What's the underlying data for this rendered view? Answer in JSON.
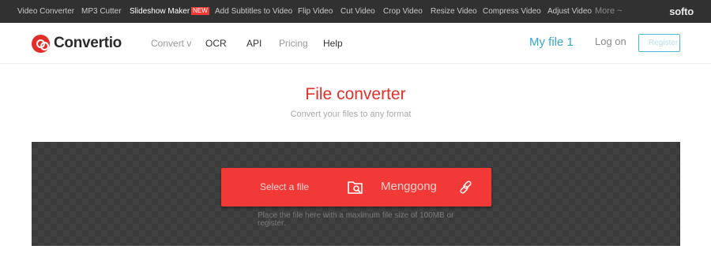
{
  "topbar": {
    "links": [
      {
        "label": "Video Converter",
        "active": false
      },
      {
        "label": "MP3 Cutter",
        "active": false
      },
      {
        "label": "Slideshow Maker",
        "active": true,
        "badge": "NEW"
      },
      {
        "label": "Add Subtitles to Video",
        "active": false
      },
      {
        "label": "Flip Video",
        "active": false
      },
      {
        "label": "Cut Video",
        "active": false
      },
      {
        "label": "Crop Video",
        "active": false
      },
      {
        "label": "Resize Video",
        "active": false
      },
      {
        "label": "Compress Video",
        "active": false
      },
      {
        "label": "Adjust Video",
        "active": false
      }
    ],
    "more": "More ~",
    "brand": "softo"
  },
  "header": {
    "logo_text": "Convertio",
    "nav": {
      "convert": "Convert v",
      "ocr": "OCR",
      "api": "API",
      "pricing": "Pricing",
      "help": "Help"
    },
    "my_file": "My file 1",
    "log_on": "Log on",
    "register": "Register"
  },
  "hero": {
    "title": "File converter",
    "subtitle": "Convert your files to any format"
  },
  "upload": {
    "select_label": "Select a file",
    "secondary_label": "Menggong",
    "hint": "Place the file here with a maximum file size of 100MB or register."
  },
  "colors": {
    "accent_red": "#f13a37",
    "brand_red": "#e32d28",
    "link_blue": "#39a6c9",
    "topbar_bg": "#313131"
  },
  "icons": {
    "logo": "convertio-logo-icon",
    "folder": "folder-search-icon",
    "link": "link-icon"
  }
}
